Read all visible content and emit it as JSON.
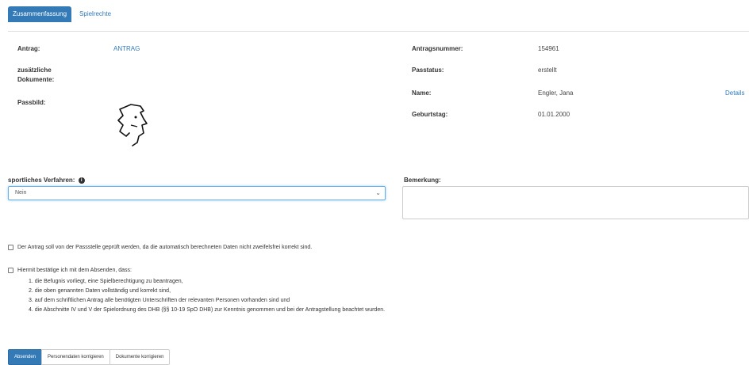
{
  "tabs": {
    "active": "Zusammenfassung",
    "other": "Spielrechte"
  },
  "left": {
    "antrag_label": "Antrag:",
    "antrag_value": "ANTRAG",
    "dokumente_label_1": "zusätzliche",
    "dokumente_label_2": "Dokumente:",
    "passbild_label": "Passbild:"
  },
  "right": {
    "nummer_label": "Antragsnummer:",
    "nummer_value": "154961",
    "status_label": "Passtatus:",
    "status_value": "erstellt",
    "name_label": "Name:",
    "name_value": "Engler, Jana",
    "details_link": "Details",
    "geburtstag_label": "Geburtstag:",
    "geburtstag_value": "01.01.2000"
  },
  "form": {
    "verfahren_label": "sportliches Verfahren:",
    "verfahren_value": "Nein",
    "info_icon": "i",
    "bemerkung_label": "Bemerkung:"
  },
  "checkboxes": {
    "pruefung": "Der Antrag soll von der Passstelle geprüft werden, da die automatisch berechneten Daten nicht zweifelsfrei korrekt sind.",
    "bestaetigung": "Hiermit bestätige ich mit dem Absenden, dass:",
    "items": [
      "1. die Befugnis vorliegt, eine Spielberechtigung zu beantragen,",
      "2. die oben genannten Daten vollständig und korrekt sind,",
      "3. auf dem schriftlichen Antrag alle benötigten Unterschriften der relevanten Personen vorhanden sind und",
      "4. die Abschnitte IV und V der Spielordnung des DHB (§§ 10-19 SpO DHB) zur Kenntnis genommen und bei der Antragstellung beachtet wurden."
    ]
  },
  "buttons": {
    "absenden": "Absenden",
    "personendaten": "Personendaten korrigieren",
    "dokumente": "Dokumente korrigieren"
  }
}
